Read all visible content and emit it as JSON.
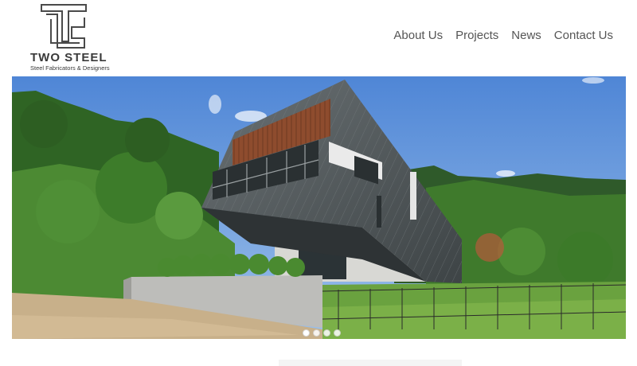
{
  "logo": {
    "title": "TWO STEEL",
    "subtitle": "Steel Fabricators & Designers"
  },
  "nav": {
    "items": [
      "About Us",
      "Projects",
      "News",
      "Contact Us"
    ]
  },
  "slider": {
    "slide_count": 4,
    "active_index": 0
  },
  "colors": {
    "sky": "#5b8fdc",
    "cladding": "#4a5052",
    "wood": "#8a4a2e",
    "foliage": "#3f7a2c"
  }
}
